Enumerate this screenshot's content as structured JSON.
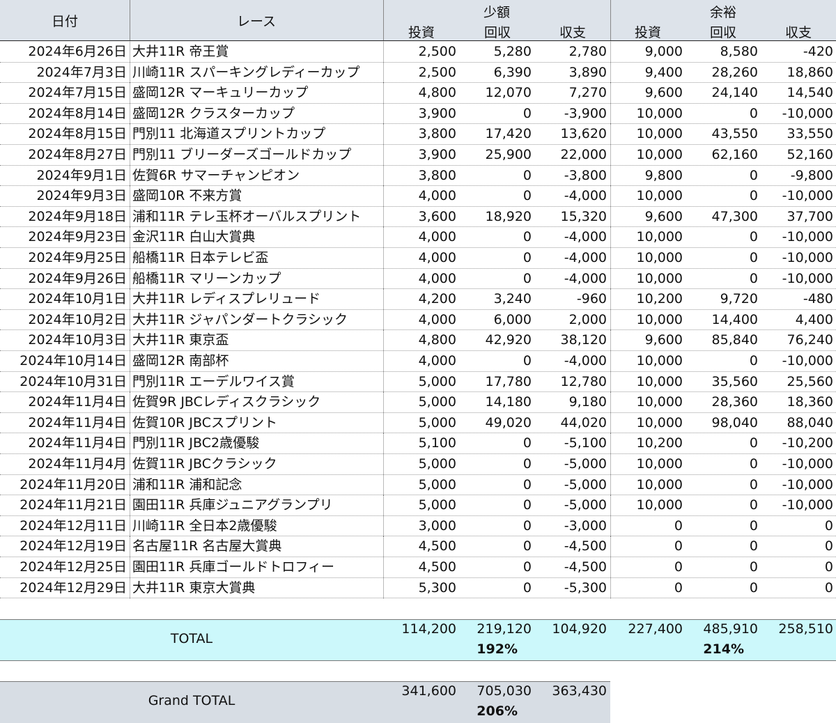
{
  "header": {
    "date": "日付",
    "race": "レース",
    "group_small": "少額",
    "group_ample": "余裕",
    "invest": "投資",
    "return": "回収",
    "balance": "収支"
  },
  "rows": [
    {
      "date": "2024年6月26日",
      "race": "大井11R 帝王賞",
      "s_inv": "2,500",
      "s_ret": "5,280",
      "s_bal": "2,780",
      "a_inv": "9,000",
      "a_ret": "8,580",
      "a_bal": "-420"
    },
    {
      "date": "2024年7月3日",
      "race": "川崎11R スパーキングレディーカップ",
      "s_inv": "2,500",
      "s_ret": "6,390",
      "s_bal": "3,890",
      "a_inv": "9,400",
      "a_ret": "28,260",
      "a_bal": "18,860"
    },
    {
      "date": "2024年7月15日",
      "race": "盛岡12R マーキュリーカップ",
      "s_inv": "4,800",
      "s_ret": "12,070",
      "s_bal": "7,270",
      "a_inv": "9,600",
      "a_ret": "24,140",
      "a_bal": "14,540"
    },
    {
      "date": "2024年8月14日",
      "race": "盛岡12R クラスターカップ",
      "s_inv": "3,900",
      "s_ret": "0",
      "s_bal": "-3,900",
      "a_inv": "10,000",
      "a_ret": "0",
      "a_bal": "-10,000"
    },
    {
      "date": "2024年8月15日",
      "race": "門別11 北海道スプリントカップ",
      "s_inv": "3,800",
      "s_ret": "17,420",
      "s_bal": "13,620",
      "a_inv": "10,000",
      "a_ret": "43,550",
      "a_bal": "33,550"
    },
    {
      "date": "2024年8月27日",
      "race": "門別11 ブリーダーズゴールドカップ",
      "s_inv": "3,900",
      "s_ret": "25,900",
      "s_bal": "22,000",
      "a_inv": "10,000",
      "a_ret": "62,160",
      "a_bal": "52,160"
    },
    {
      "date": "2024年9月1日",
      "race": "佐賀6R サマーチャンピオン",
      "s_inv": "3,800",
      "s_ret": "0",
      "s_bal": "-3,800",
      "a_inv": "9,800",
      "a_ret": "0",
      "a_bal": "-9,800"
    },
    {
      "date": "2024年9月3日",
      "race": "盛岡10R 不来方賞",
      "s_inv": "4,000",
      "s_ret": "0",
      "s_bal": "-4,000",
      "a_inv": "10,000",
      "a_ret": "0",
      "a_bal": "-10,000"
    },
    {
      "date": "2024年9月18日",
      "race": "浦和11R テレ玉杯オーバルスプリント",
      "s_inv": "3,600",
      "s_ret": "18,920",
      "s_bal": "15,320",
      "a_inv": "9,600",
      "a_ret": "47,300",
      "a_bal": "37,700"
    },
    {
      "date": "2024年9月23日",
      "race": "金沢11R 白山大賞典",
      "s_inv": "4,000",
      "s_ret": "0",
      "s_bal": "-4,000",
      "a_inv": "10,000",
      "a_ret": "0",
      "a_bal": "-10,000"
    },
    {
      "date": "2024年9月25日",
      "race": "船橋11R 日本テレビ盃",
      "s_inv": "4,000",
      "s_ret": "0",
      "s_bal": "-4,000",
      "a_inv": "10,000",
      "a_ret": "0",
      "a_bal": "-10,000"
    },
    {
      "date": "2024年9月26日",
      "race": "船橋11R マリーンカップ",
      "s_inv": "4,000",
      "s_ret": "0",
      "s_bal": "-4,000",
      "a_inv": "10,000",
      "a_ret": "0",
      "a_bal": "-10,000"
    },
    {
      "date": "2024年10月1日",
      "race": "大井11R レディスプレリュード",
      "s_inv": "4,200",
      "s_ret": "3,240",
      "s_bal": "-960",
      "a_inv": "10,200",
      "a_ret": "9,720",
      "a_bal": "-480"
    },
    {
      "date": "2024年10月2日",
      "race": "大井11R ジャパンダートクラシック",
      "s_inv": "4,000",
      "s_ret": "6,000",
      "s_bal": "2,000",
      "a_inv": "10,000",
      "a_ret": "14,400",
      "a_bal": "4,400"
    },
    {
      "date": "2024年10月3日",
      "race": "大井11R 東京盃",
      "s_inv": "4,800",
      "s_ret": "42,920",
      "s_bal": "38,120",
      "a_inv": "9,600",
      "a_ret": "85,840",
      "a_bal": "76,240"
    },
    {
      "date": "2024年10月14日",
      "race": "盛岡12R 南部杯",
      "s_inv": "4,000",
      "s_ret": "0",
      "s_bal": "-4,000",
      "a_inv": "10,000",
      "a_ret": "0",
      "a_bal": "-10,000"
    },
    {
      "date": "2024年10月31日",
      "race": "門別11R エーデルワイス賞",
      "s_inv": "5,000",
      "s_ret": "17,780",
      "s_bal": "12,780",
      "a_inv": "10,000",
      "a_ret": "35,560",
      "a_bal": "25,560"
    },
    {
      "date": "2024年11月4日",
      "race": "佐賀9R JBCレディスクラシック",
      "s_inv": "5,000",
      "s_ret": "14,180",
      "s_bal": "9,180",
      "a_inv": "10,000",
      "a_ret": "28,360",
      "a_bal": "18,360"
    },
    {
      "date": "2024年11月4日",
      "race": "佐賀10R JBCスプリント",
      "s_inv": "5,000",
      "s_ret": "49,020",
      "s_bal": "44,020",
      "a_inv": "10,000",
      "a_ret": "98,040",
      "a_bal": "88,040"
    },
    {
      "date": "2024年11月4日",
      "race": "門別11R JBC2歳優駿",
      "s_inv": "5,100",
      "s_ret": "0",
      "s_bal": "-5,100",
      "a_inv": "10,200",
      "a_ret": "0",
      "a_bal": "-10,200"
    },
    {
      "date": "2024年11月4月",
      "race": "佐賀11R JBCクラシック",
      "s_inv": "5,000",
      "s_ret": "0",
      "s_bal": "-5,000",
      "a_inv": "10,000",
      "a_ret": "0",
      "a_bal": "-10,000"
    },
    {
      "date": "2024年11月20日",
      "race": "浦和11R 浦和記念",
      "s_inv": "5,000",
      "s_ret": "0",
      "s_bal": "-5,000",
      "a_inv": "10,000",
      "a_ret": "0",
      "a_bal": "-10,000"
    },
    {
      "date": "2024年11月21日",
      "race": "園田11R 兵庫ジュニアグランプリ",
      "s_inv": "5,000",
      "s_ret": "0",
      "s_bal": "-5,000",
      "a_inv": "10,000",
      "a_ret": "0",
      "a_bal": "-10,000"
    },
    {
      "date": "2024年12月11日",
      "race": "川崎11R 全日本2歳優駿",
      "s_inv": "3,000",
      "s_ret": "0",
      "s_bal": "-3,000",
      "a_inv": "0",
      "a_ret": "0",
      "a_bal": "0"
    },
    {
      "date": "2024年12月19日",
      "race": "名古屋11R 名古屋大賞典",
      "s_inv": "4,500",
      "s_ret": "0",
      "s_bal": "-4,500",
      "a_inv": "0",
      "a_ret": "0",
      "a_bal": "0"
    },
    {
      "date": "2024年12月25日",
      "race": "園田11R 兵庫ゴールドトロフィー",
      "s_inv": "4,500",
      "s_ret": "0",
      "s_bal": "-4,500",
      "a_inv": "0",
      "a_ret": "0",
      "a_bal": "0"
    },
    {
      "date": "2024年12月29日",
      "race": "大井11R 東京大賞典",
      "s_inv": "5,300",
      "s_ret": "0",
      "s_bal": "-5,300",
      "a_inv": "0",
      "a_ret": "0",
      "a_bal": "0"
    }
  ],
  "total": {
    "label": "TOTAL",
    "s_inv": "114,200",
    "s_ret": "219,120",
    "s_bal": "104,920",
    "a_inv": "227,400",
    "a_ret": "485,910",
    "a_bal": "258,510",
    "s_pct": "192%",
    "a_pct": "214%"
  },
  "grand_total": {
    "label": "Grand TOTAL",
    "inv": "341,600",
    "ret": "705,030",
    "bal": "363,430",
    "pct": "206%"
  }
}
